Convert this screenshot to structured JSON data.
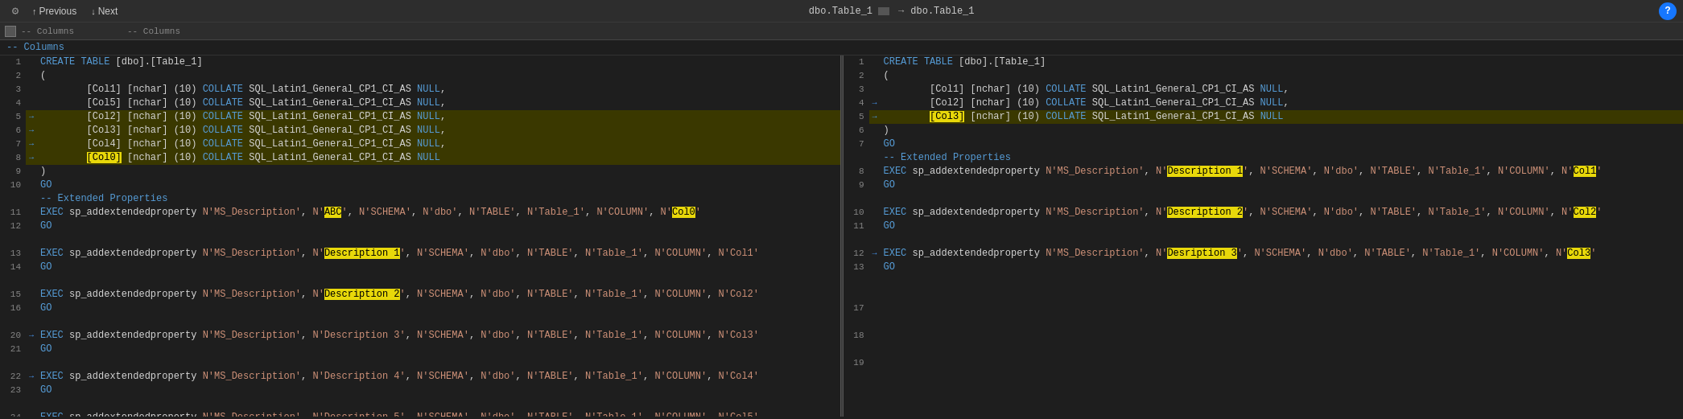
{
  "toolbar": {
    "gear_label": "⚙",
    "previous_label": "Previous",
    "next_label": "Next",
    "tab_left_title": "dbo.Table_1",
    "tab_right_title": "dbo.Table_1",
    "arrow_symbol": "→",
    "help_label": "?",
    "stop_label": "",
    "comment_columns": "-- Columns"
  },
  "left_editor": {
    "comment_line": "-- Columns",
    "lines": []
  },
  "right_editor": {
    "comment_line": "-- Columns",
    "lines": []
  }
}
